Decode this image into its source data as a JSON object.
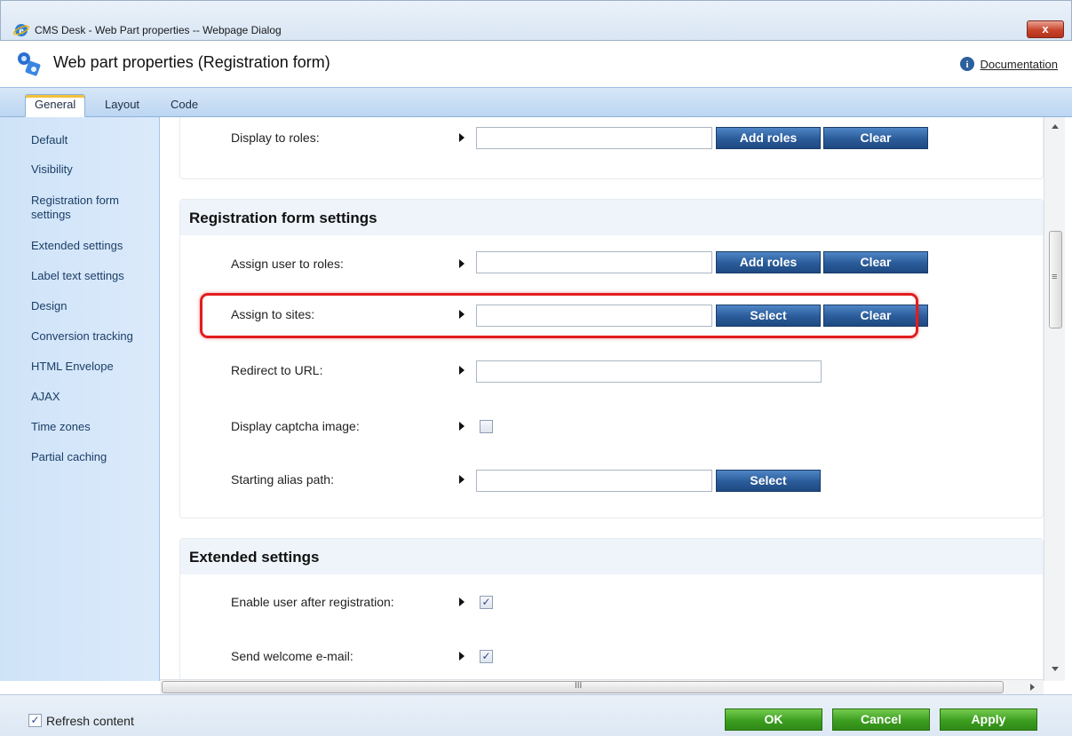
{
  "window": {
    "title": "CMS Desk - Web Part properties -- Webpage Dialog",
    "close_label": "x"
  },
  "header": {
    "title": "Web part properties (Registration form)",
    "documentation_link": "Documentation"
  },
  "tabs": [
    {
      "label": "General",
      "active": true
    },
    {
      "label": "Layout",
      "active": false
    },
    {
      "label": "Code",
      "active": false
    }
  ],
  "sidebar": {
    "items": [
      {
        "label": "Default"
      },
      {
        "label": "Visibility"
      },
      {
        "label": "Registration form settings"
      },
      {
        "label": "Extended settings"
      },
      {
        "label": "Label text settings"
      },
      {
        "label": "Design"
      },
      {
        "label": "Conversion tracking"
      },
      {
        "label": "HTML Envelope"
      },
      {
        "label": "AJAX"
      },
      {
        "label": "Time zones"
      },
      {
        "label": "Partial caching"
      }
    ]
  },
  "visibility_section": {
    "display_to_roles": {
      "label": "Display to roles:",
      "value": "",
      "add_label": "Add roles",
      "clear_label": "Clear"
    }
  },
  "registration_section": {
    "title": "Registration form settings",
    "assign_user_to_roles": {
      "label": "Assign user to roles:",
      "value": "",
      "add_label": "Add roles",
      "clear_label": "Clear"
    },
    "assign_to_sites": {
      "label": "Assign to sites:",
      "value": "",
      "select_label": "Select",
      "clear_label": "Clear"
    },
    "redirect_to_url": {
      "label": "Redirect to URL:",
      "value": ""
    },
    "display_captcha": {
      "label": "Display captcha image:",
      "checked": false
    },
    "starting_alias_path": {
      "label": "Starting alias path:",
      "value": "",
      "select_label": "Select"
    }
  },
  "extended_section": {
    "title": "Extended settings",
    "enable_user": {
      "label": "Enable user after registration:",
      "checked": true
    },
    "send_welcome": {
      "label": "Send welcome e-mail:",
      "checked": true
    }
  },
  "footer": {
    "refresh_content_label": "Refresh content",
    "refresh_content_checked": true,
    "ok_label": "OK",
    "cancel_label": "Cancel",
    "apply_label": "Apply"
  },
  "scrollbar": {
    "h_grip": "III",
    "v_grip": "≡"
  },
  "colors": {
    "primary_button": "#2a5b99",
    "confirm_button": "#3c9e20",
    "highlight": "#e21d1d",
    "sidebar_bg": "#cfe3f8"
  }
}
